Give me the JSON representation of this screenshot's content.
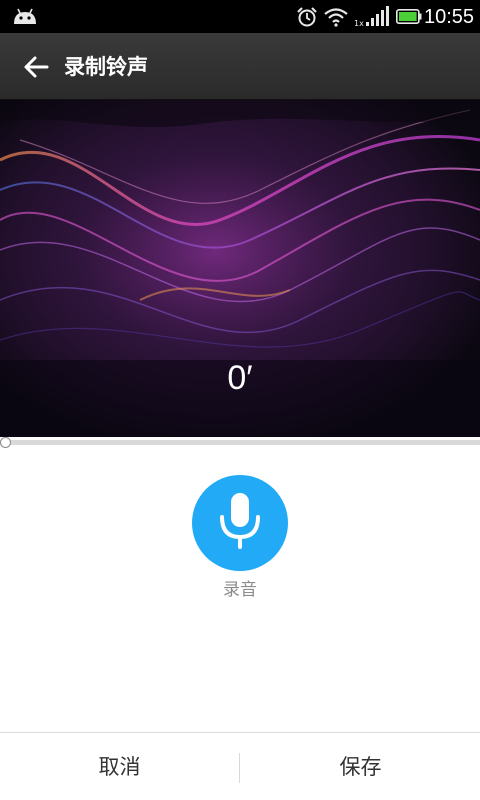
{
  "status_bar": {
    "time": "10:55",
    "icons": [
      "android-icon",
      "alarm-icon",
      "wifi-icon",
      "signal-icon",
      "battery-icon"
    ],
    "battery_color": "#4cd037"
  },
  "action_bar": {
    "title": "录制铃声",
    "back_icon": "arrow-left-icon"
  },
  "visual": {
    "timer": "0′"
  },
  "progress": {
    "value": 0
  },
  "record": {
    "icon": "microphone-icon",
    "label": "录音",
    "color": "#22aaf6"
  },
  "bottom_bar": {
    "cancel_label": "取消",
    "save_label": "保存"
  }
}
